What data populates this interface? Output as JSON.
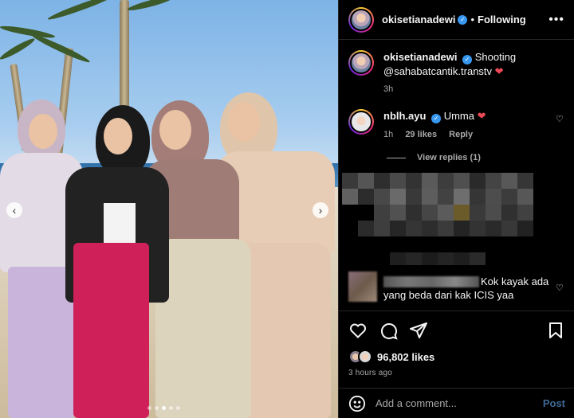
{
  "post_author": {
    "username": "okisetianadewi",
    "verified": true,
    "separator": "•",
    "follow_status": "Following",
    "more_icon": "more-horizontal-icon"
  },
  "caption": {
    "username": "okisetianadewi",
    "text": "Shooting @sahabatcantik.transtv",
    "emoji": "❤",
    "time": "3h"
  },
  "comments": [
    {
      "username": "nblh.ayu",
      "verified": true,
      "text": "Umma",
      "emoji": "❤",
      "time": "1h",
      "likes": "29 likes",
      "reply_label": "Reply",
      "view_replies": "View replies (1)"
    },
    {
      "username": "",
      "text": "Kok kayak ada yang beda dari kak ICIS yaa"
    }
  ],
  "actions": {
    "like_icon": "heart-icon",
    "comment_icon": "comment-icon",
    "share_icon": "send-icon",
    "save_icon": "bookmark-icon"
  },
  "likes": "96,802 likes",
  "posted": "3 hours ago",
  "add_comment": {
    "placeholder": "Add a comment...",
    "post_label": "Post",
    "emoji_icon": "smiley-icon"
  },
  "carousel": {
    "prev_icon": "chevron-left-icon",
    "next_icon": "chevron-right-icon",
    "prev_glyph": "‹",
    "next_glyph": "›",
    "dots": 5,
    "active_dot": 2
  },
  "colors": {
    "accent": "#3897f0",
    "like_red": "#ed4956",
    "post_blue": "#3f6a95"
  }
}
